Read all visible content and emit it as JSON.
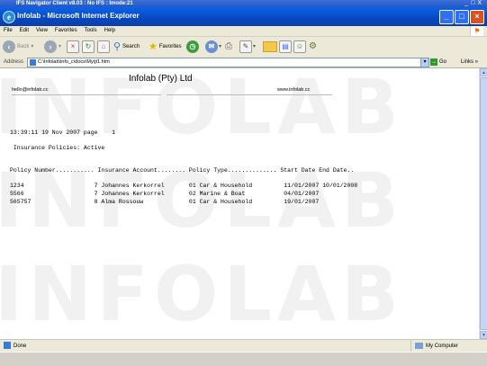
{
  "outer_window": {
    "title": "IFS Navigator Client v8.03 : No IFS :       Imode:21"
  },
  "browser": {
    "title": "Infolab - Microsoft Internet Explorer",
    "menu": [
      "File",
      "Edit",
      "View",
      "Favorites",
      "Tools",
      "Help"
    ],
    "toolbar": {
      "back": "Back",
      "search": "Search",
      "favorites": "Favorites"
    },
    "address_label": "Address",
    "address_value": "C:\\Infolab\\info_c\\docs\\My\\jt1.htm",
    "go_label": "Go",
    "links_label": "Links",
    "status": {
      "left": "Done",
      "right": "My Computer"
    }
  },
  "watermark": "INFOLAB",
  "report": {
    "company": "Infolab (Pty) Ltd",
    "email": "hello@infolab.cc",
    "website": "www.infolab.cc",
    "timestamp_line": "13:39:11 19 Nov 2007 page    1",
    "subtitle": " Insurance Policies: Active",
    "header_line": "Policy Number........... Insurance Account........ Policy Type.............. Start Date End Date..",
    "rows": [
      "1234                    7 Johannes Kerkorrel       01 Car & Household         11/01/2007 10/01/2008",
      "5566                    7 Johannes Kerkorrel       02 Marine & Boat           04/01/2007",
      "565757                  8 Alma Rossouw             01 Car & Household         19/01/2007"
    ]
  }
}
